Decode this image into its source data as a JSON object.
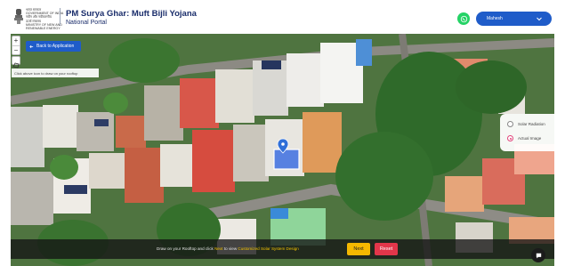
{
  "header": {
    "ministry_lines": [
      "भारत सरकार",
      "GOVERNMENT OF INDIA",
      "नवीन और नवीकरणीय",
      "ऊर्जा मंत्रालय",
      "MINISTRY OF NEW AND",
      "RENEWABLE ENERGY"
    ],
    "title": "PM Surya Ghar: Muft Bijli Yojana",
    "subtitle": "National Portal",
    "user_name": "Mahesh",
    "whatsapp_icon": "whatsapp-icon",
    "user_dropdown_icon": "chevron-down-icon"
  },
  "map": {
    "zoom_in": "+",
    "zoom_out": "−",
    "back_button": "Back to Application",
    "hint": "Click above icon to draw on your rooftop",
    "marker_icon": "map-pin-icon",
    "layers": [
      {
        "label": "Solar Radiation",
        "selected": false
      },
      {
        "label": "Actual Image",
        "selected": true
      }
    ]
  },
  "bottom": {
    "instr_pre": "Draw on your Rooftop and click ",
    "instr_next": "Next",
    "instr_mid": " to view ",
    "instr_link": "Customized Solar System Design",
    "next_label": "Next",
    "reset_label": "Reset",
    "chat_icon": "chat-bubble-icon"
  },
  "colors": {
    "brand_blue": "#1f5cc9",
    "next_yellow": "#f5b800",
    "reset_red": "#e2364a",
    "highlight_polygon": "#3d6fe0",
    "marker_blue": "#2f6fd8"
  }
}
